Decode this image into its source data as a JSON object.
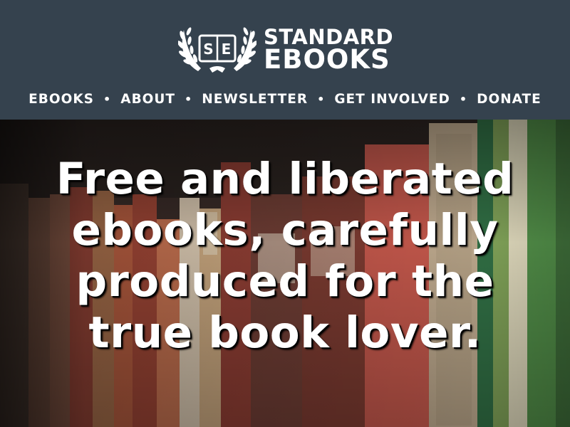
{
  "logo": {
    "monogram": "S|E",
    "line1": "STANDARD",
    "line2": "EBOOKS",
    "icon": "laurel-book-icon"
  },
  "nav": {
    "items": [
      "EBOOKS",
      "ABOUT",
      "NEWSLETTER",
      "GET INVOLVED",
      "DONATE"
    ],
    "separator": "•"
  },
  "hero": {
    "title": "Free and liberated ebooks, carefully produced for the true book lover."
  },
  "colors": {
    "header_bg": "#35424e",
    "text": "#ffffff"
  }
}
